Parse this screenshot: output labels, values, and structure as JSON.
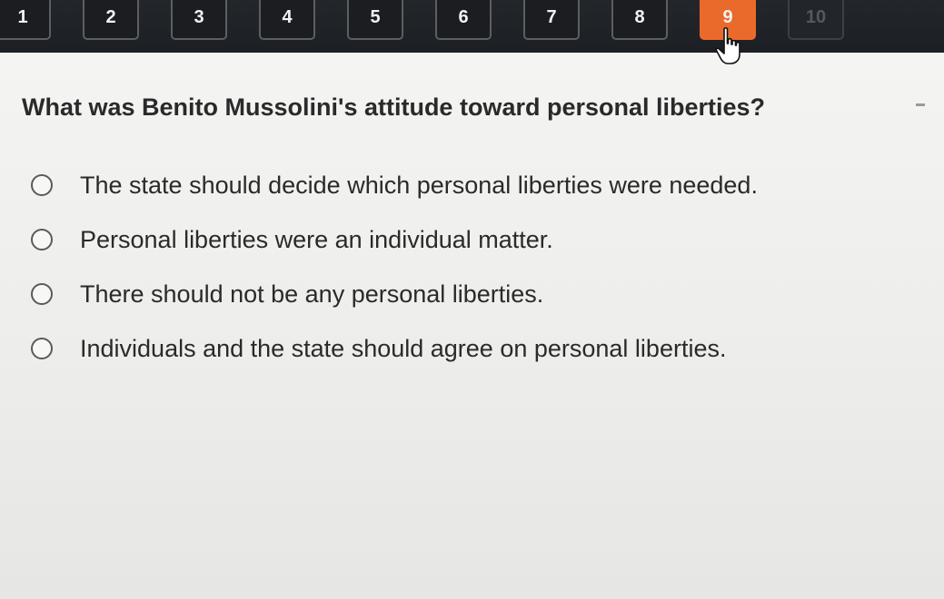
{
  "question_nav": {
    "buttons": [
      {
        "label": "1",
        "state": "normal"
      },
      {
        "label": "2",
        "state": "normal"
      },
      {
        "label": "3",
        "state": "normal"
      },
      {
        "label": "4",
        "state": "normal"
      },
      {
        "label": "5",
        "state": "normal"
      },
      {
        "label": "6",
        "state": "normal"
      },
      {
        "label": "7",
        "state": "normal"
      },
      {
        "label": "8",
        "state": "normal"
      },
      {
        "label": "9",
        "state": "current"
      },
      {
        "label": "10",
        "state": "disabled"
      }
    ]
  },
  "question": {
    "text": "What was Benito Mussolini's attitude toward personal liberties?"
  },
  "answers": [
    {
      "label": "The state should decide which personal liberties were needed."
    },
    {
      "label": "Personal liberties were an individual matter."
    },
    {
      "label": "There should not be any personal liberties."
    },
    {
      "label": "Individuals and the state should agree on personal liberties."
    }
  ],
  "colors": {
    "current_question": "#ea6a2c",
    "nav_background": "#1c1f23",
    "page_background": "#efefee"
  },
  "icons": {
    "cursor": "hand-pointer-icon",
    "audio": "speaker-icon"
  }
}
